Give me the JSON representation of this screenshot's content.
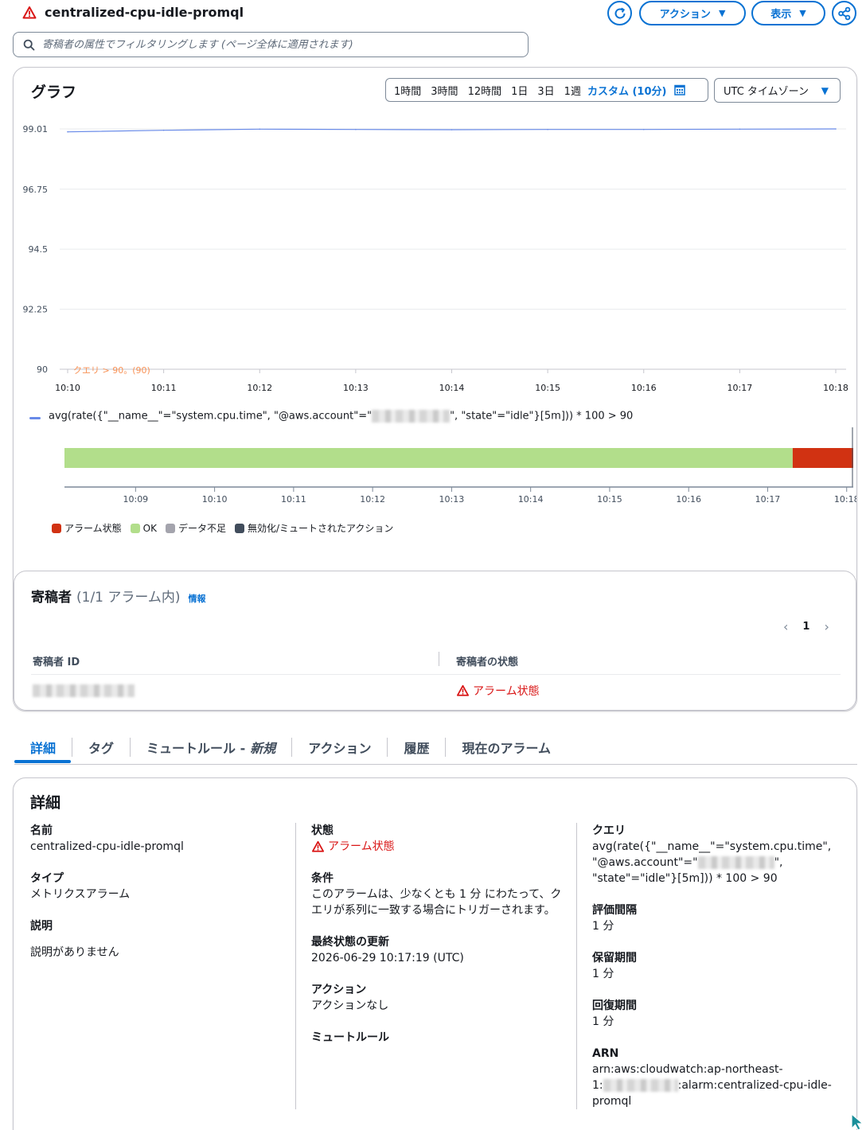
{
  "header": {
    "alarm_name": "centralized-cpu-idle-promql",
    "actions_button": "アクション",
    "view_button": "表示"
  },
  "filter": {
    "placeholder": "寄稿者の属性でフィルタリングします (ページ全体に適用されます)"
  },
  "graph": {
    "title": "グラフ",
    "ranges": [
      "1時間",
      "3時間",
      "12時間",
      "1日",
      "3日",
      "1週"
    ],
    "custom_range": "カスタム (10分)",
    "timezone": "UTC タイムゾーン",
    "legend_prefix": "avg(rate({\"__name__\"=\"system.cpu.time\", \"@aws.account\"=\"",
    "legend_suffix": "\", \"state\"=\"idle\"}[5m])) * 100 > 90"
  },
  "chart_data": {
    "type": "line",
    "yticks": [
      "99.01",
      "96.75",
      "94.5",
      "92.25",
      "90"
    ],
    "ylim": [
      90,
      99.01
    ],
    "xticks": [
      "10:10",
      "10:11",
      "10:12",
      "10:13",
      "10:14",
      "10:15",
      "10:16",
      "10:17",
      "10:18"
    ],
    "series": [
      {
        "color": "#688ae8",
        "x": [
          "10:10",
          "10:11",
          "10:12",
          "10:13",
          "10:14",
          "10:15",
          "10:16",
          "10:17",
          "10:18"
        ],
        "values": [
          98.9,
          98.96,
          99.0,
          98.99,
          98.98,
          98.99,
          98.99,
          99.0,
          99.01
        ]
      }
    ],
    "threshold": {
      "label": "クエリ > 90。(90)",
      "value": 90,
      "color": "#f89256"
    }
  },
  "state_timeline": {
    "xticks": [
      "10:09",
      "10:10",
      "10:11",
      "10:12",
      "10:13",
      "10:14",
      "10:15",
      "10:16",
      "10:17",
      "10:18"
    ],
    "segments": [
      {
        "state": "OK",
        "from": "10:08:06",
        "to": "10:17:19",
        "color": "#b2de8b"
      },
      {
        "state": "アラーム状態",
        "from": "10:17:19",
        "to": "10:18:05",
        "color": "#d13212"
      }
    ],
    "legend": [
      {
        "label": "アラーム状態",
        "color": "#d13212"
      },
      {
        "label": "OK",
        "color": "#b2de8b"
      },
      {
        "label": "データ不足",
        "color": "#a4a4ad"
      },
      {
        "label": "無効化/ミュートされたアクション",
        "color": "#414d5c"
      }
    ]
  },
  "contributors": {
    "title": "寄稿者",
    "count": "(1/1 アラーム内)",
    "info": "情報",
    "page": "1",
    "col_id": "寄稿者 ID",
    "col_state": "寄稿者の状態",
    "row_state": "アラーム状態"
  },
  "tabs": {
    "details": "詳細",
    "tags": "タグ",
    "mute_rules": "ミュートルール -",
    "mute_rules_new": "新規",
    "actions": "アクション",
    "history": "履歴",
    "current_alarms": "現在のアラーム"
  },
  "details": {
    "title": "詳細",
    "name_k": "名前",
    "name_v": "centralized-cpu-idle-promql",
    "type_k": "タイプ",
    "type_v": "メトリクスアラーム",
    "desc_k": "説明",
    "desc_v": "説明がありません",
    "state_k": "状態",
    "state_v": "アラーム状態",
    "cond_k": "条件",
    "cond_v1": "このアラームは、少なくとも 1 分 にわたって、ク",
    "cond_v2": "エリが系列に一致する場合にトリガーされます。",
    "updated_k": "最終状態の更新",
    "updated_v": "2026-06-29 10:17:19 (UTC)",
    "actions_k": "アクション",
    "actions_v": "アクションなし",
    "mute_k": "ミュートルール",
    "query_k": "クエリ",
    "query_v1": "avg(rate({\"__name__\"=\"system.cpu.time\",",
    "query_v2a": "\"@aws.account\"=\"",
    "query_v2b": "\",",
    "query_v3": "\"state\"=\"idle\"}[5m])) * 100 > 90",
    "eval_k": "評価間隔",
    "eval_v": "1 分",
    "retain_k": "保留期間",
    "retain_v": "1 分",
    "recover_k": "回復期間",
    "recover_v": "1 分",
    "arn_k": "ARN",
    "arn_v1": "arn:aws:cloudwatch:ap-northeast-",
    "arn_v2a": "1:",
    "arn_v2b": ":alarm:centralized-cpu-idle-",
    "arn_v3": "promql"
  }
}
